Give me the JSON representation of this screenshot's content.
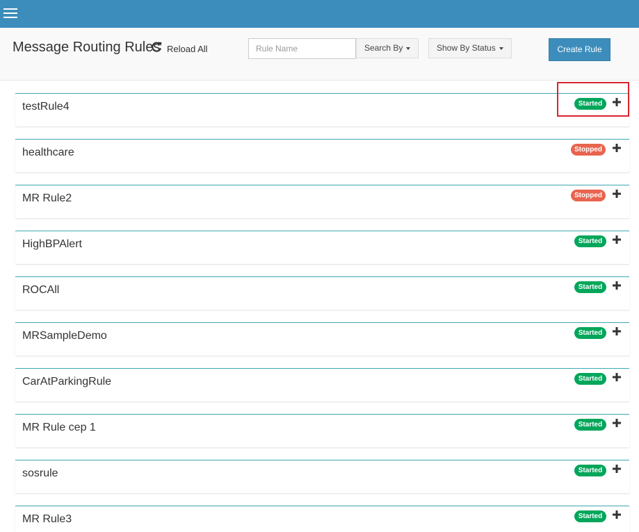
{
  "header": {
    "title": "Message Routing Rules",
    "reload_label": "Reload All",
    "search_placeholder": "Rule Name",
    "search_by_label": "Search By",
    "show_by_status_label": "Show By Status",
    "create_rule_label": "Create Rule"
  },
  "rules": [
    {
      "name": "testRule4",
      "status": "Started"
    },
    {
      "name": "healthcare",
      "status": "Stopped"
    },
    {
      "name": "MR Rule2",
      "status": "Stopped"
    },
    {
      "name": "HighBPAlert",
      "status": "Started"
    },
    {
      "name": "ROCAll",
      "status": "Started"
    },
    {
      "name": "MRSampleDemo",
      "status": "Started"
    },
    {
      "name": "CarAtParkingRule",
      "status": "Started"
    },
    {
      "name": "MR Rule cep 1",
      "status": "Started"
    },
    {
      "name": "sosrule",
      "status": "Started"
    },
    {
      "name": "MR Rule3",
      "status": "Started"
    }
  ],
  "colors": {
    "topbar": "#3c8dbc",
    "started": "#00a65a",
    "stopped": "#e8644f",
    "card_border": "#3ea9b4",
    "highlight": "#d9232e"
  },
  "icons": {
    "menu": "hamburger-icon",
    "reload": "refresh-icon",
    "expand": "plus-icon"
  }
}
